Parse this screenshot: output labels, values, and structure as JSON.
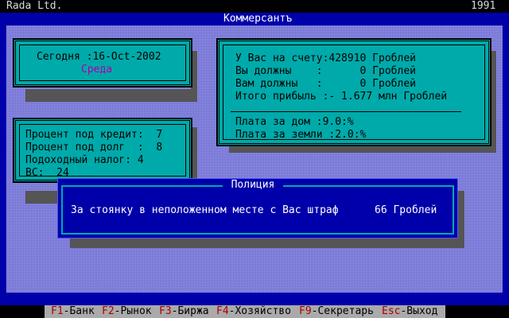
{
  "top_bar": {
    "company": "Rada Ltd.",
    "year": "1991"
  },
  "window_title": "Коммерсантъ",
  "date_panel": {
    "date_line": "Сегодня :16-Oct-2002",
    "weekday": "Среда"
  },
  "account_panel": {
    "lines": [
      "У Вас на счету:428910 Гроблей",
      "Вы должны    :      0 Гроблей",
      "Вам должны   :      0 Гроблей",
      "Итого прибыль :- 1.677 млн Гроблей"
    ],
    "fees": [
      "Плата за дом :9.0:%",
      "Плата за земли :2.0:%"
    ]
  },
  "rates_panel": {
    "lines": [
      "Процент под кредит:  7",
      "Процент под долг  :  8",
      "Подоходный налог: 4",
      "ВС:  24"
    ]
  },
  "police_dialog": {
    "title": "Полиция",
    "message": "За стоянку в неположенном месте с Вас штраф",
    "amount": "66 Гроблей"
  },
  "function_keys": [
    {
      "key": "F1",
      "label": "-Банк"
    },
    {
      "key": "F2",
      "label": "-Рынок"
    },
    {
      "key": "F3",
      "label": "-Биржа"
    },
    {
      "key": "F4",
      "label": "-Хозяйство"
    },
    {
      "key": "F9",
      "label": "-Секретарь"
    },
    {
      "key": "Esc",
      "label": "-Выход"
    }
  ],
  "colors": {
    "frame": "#0000aa",
    "panel": "#00aaaa",
    "key_red": "#aa0000",
    "weekday": "#aa00aa"
  }
}
